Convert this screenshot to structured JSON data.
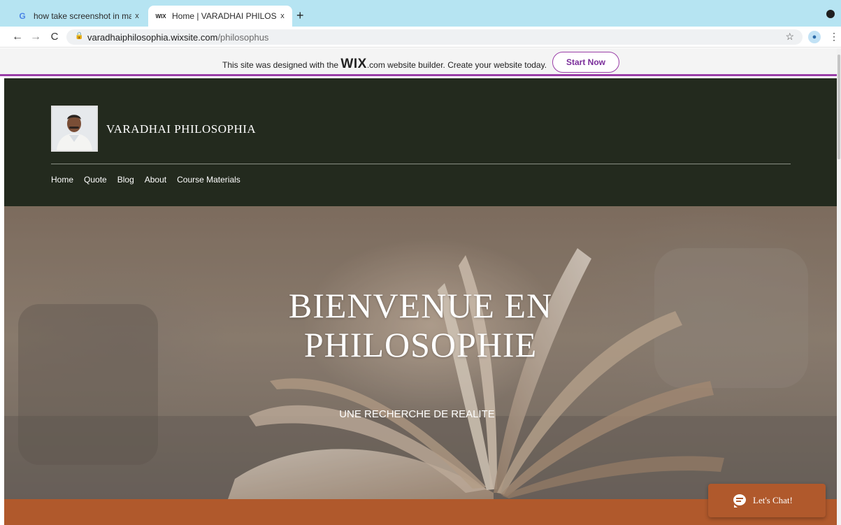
{
  "browser": {
    "tabs": [
      {
        "title": "how take screenshot in macbo",
        "favicon": "google-g-icon",
        "favicon_text": "G",
        "active": false
      },
      {
        "title": "Home | VARADHAI PHILOSOPH",
        "favicon": "wix-icon",
        "favicon_text": "WIX",
        "active": true
      }
    ],
    "new_tab_label": "+",
    "close_label": "x",
    "url_host": "varadhaiphilosophia.wixsite.com",
    "url_path": "/philosophus"
  },
  "wix_banner": {
    "text_before": "This site was designed with the ",
    "logo": "WIX",
    "text_after": ".com website builder. Create your website today.",
    "cta": "Start Now"
  },
  "site": {
    "name": "VARADHAI PHILOSOPHIA",
    "menu": [
      "Home",
      "Quote",
      "Blog",
      "About",
      "Course Materials"
    ],
    "hero_title_line1": "BIENVENUE EN",
    "hero_title_line2": "PHILOSOPHIE",
    "hero_subtitle": "UNE RECHERCHE DE REALITE",
    "chat_label": "Let's Chat!"
  },
  "colors": {
    "header_bg": "#232a1e",
    "accent": "#b0592c",
    "wix_purple": "#9a3ea8",
    "tab_strip": "#b6e4f2"
  }
}
